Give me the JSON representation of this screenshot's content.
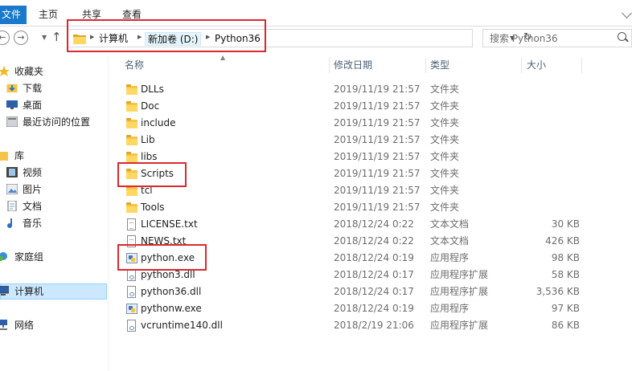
{
  "ribbon": {
    "file_tab": "文件",
    "tabs": [
      "主页",
      "共享",
      "查看"
    ]
  },
  "address": {
    "breadcrumbs": [
      "计算机",
      "新加卷 (D:)",
      "Python36"
    ]
  },
  "search": {
    "placeholder": "搜索 Python36"
  },
  "nav": {
    "items": [
      {
        "label": "收藏夹",
        "icon": "star-icon"
      },
      {
        "label": "下载",
        "icon": "download-folder-icon"
      },
      {
        "label": "桌面",
        "icon": "desktop-icon"
      },
      {
        "label": "最近访问的位置",
        "icon": "recent-places-icon"
      },
      {
        "label": "库",
        "icon": "library-icon"
      },
      {
        "label": "视频",
        "icon": "video-icon"
      },
      {
        "label": "图片",
        "icon": "pictures-icon"
      },
      {
        "label": "文档",
        "icon": "documents-icon"
      },
      {
        "label": "音乐",
        "icon": "music-icon"
      },
      {
        "label": "家庭组",
        "icon": "homegroup-icon"
      },
      {
        "label": "计算机",
        "icon": "computer-icon",
        "selected": true
      },
      {
        "label": "网络",
        "icon": "network-icon"
      }
    ]
  },
  "columns": {
    "name": "名称",
    "date": "修改日期",
    "type": "类型",
    "size": "大小"
  },
  "files": [
    {
      "name": "DLLs",
      "date": "2019/11/19 21:57",
      "type": "文件夹",
      "size": "",
      "icon": "folder-icon"
    },
    {
      "name": "Doc",
      "date": "2019/11/19 21:57",
      "type": "文件夹",
      "size": "",
      "icon": "folder-icon"
    },
    {
      "name": "include",
      "date": "2019/11/19 21:57",
      "type": "文件夹",
      "size": "",
      "icon": "folder-icon"
    },
    {
      "name": "Lib",
      "date": "2019/11/19 21:57",
      "type": "文件夹",
      "size": "",
      "icon": "folder-icon"
    },
    {
      "name": "libs",
      "date": "2019/11/19 21:57",
      "type": "文件夹",
      "size": "",
      "icon": "folder-icon"
    },
    {
      "name": "Scripts",
      "date": "2019/11/19 21:57",
      "type": "文件夹",
      "size": "",
      "icon": "folder-icon"
    },
    {
      "name": "tcl",
      "date": "2019/11/19 21:57",
      "type": "文件夹",
      "size": "",
      "icon": "folder-icon"
    },
    {
      "name": "Tools",
      "date": "2019/11/19 21:57",
      "type": "文件夹",
      "size": "",
      "icon": "folder-icon"
    },
    {
      "name": "LICENSE.txt",
      "date": "2018/12/24 0:22",
      "type": "文本文档",
      "size": "30 KB",
      "icon": "text-file-icon"
    },
    {
      "name": "NEWS.txt",
      "date": "2018/12/24 0:22",
      "type": "文本文档",
      "size": "426 KB",
      "icon": "text-file-icon"
    },
    {
      "name": "python.exe",
      "date": "2018/12/24 0:19",
      "type": "应用程序",
      "size": "98 KB",
      "icon": "python-exe-icon"
    },
    {
      "name": "python3.dll",
      "date": "2018/12/24 0:17",
      "type": "应用程序扩展",
      "size": "58 KB",
      "icon": "dll-file-icon"
    },
    {
      "name": "python36.dll",
      "date": "2018/12/24 0:17",
      "type": "应用程序扩展",
      "size": "3,536 KB",
      "icon": "dll-file-icon"
    },
    {
      "name": "pythonw.exe",
      "date": "2018/12/24 0:19",
      "type": "应用程序",
      "size": "97 KB",
      "icon": "python-exe-icon"
    },
    {
      "name": "vcruntime140.dll",
      "date": "2018/2/19 21:06",
      "type": "应用程序扩展",
      "size": "86 KB",
      "icon": "dll-file-icon"
    }
  ],
  "colors": {
    "file_tab": "#1979ca",
    "annotation": "#d9292f",
    "selection": "#cce8ff",
    "folder": "#f5c547"
  }
}
